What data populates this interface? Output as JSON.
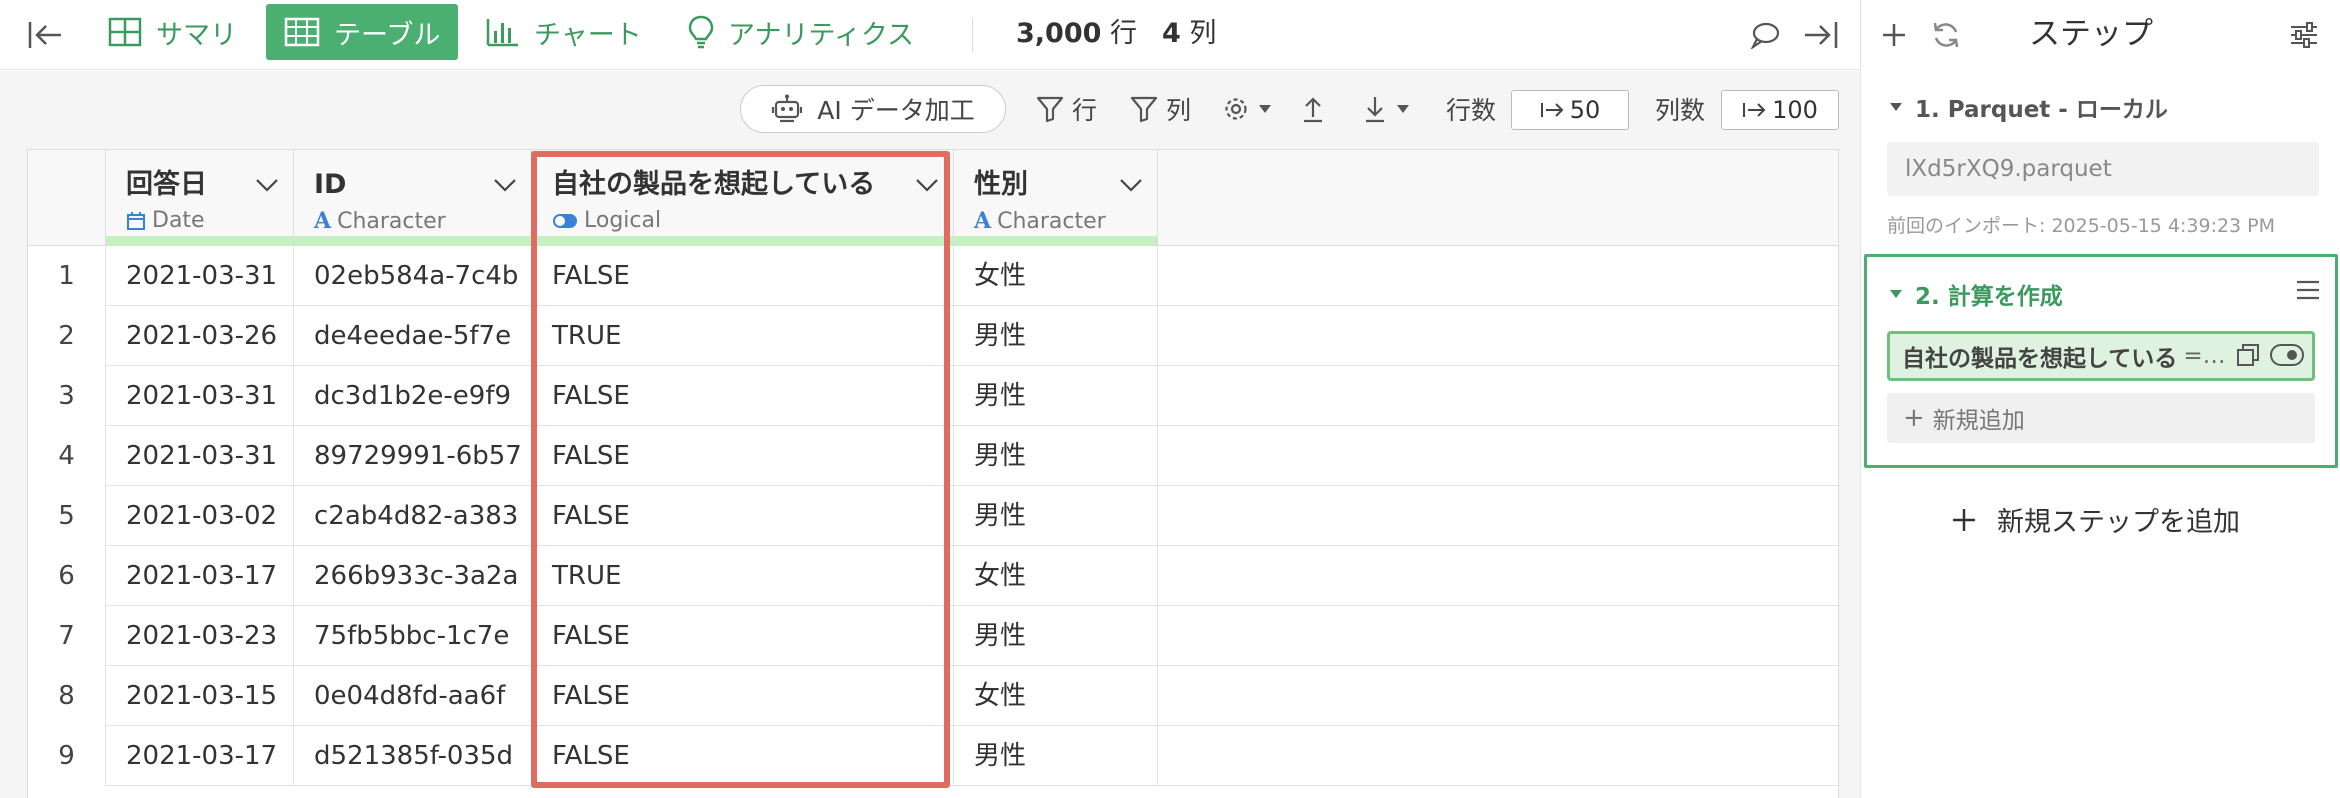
{
  "topbar": {
    "tabs": [
      {
        "label": "サマリ",
        "icon": "summary-grid-icon"
      },
      {
        "label": "テーブル",
        "icon": "table-icon",
        "active": true
      },
      {
        "label": "チャート",
        "icon": "bar-chart-icon"
      },
      {
        "label": "アナリティクス",
        "icon": "lightbulb-icon"
      }
    ],
    "rows_count": "3,000",
    "rows_unit": "行",
    "cols_count": "4",
    "cols_unit": "列"
  },
  "toolbar": {
    "ai_label": "AI データ加工",
    "row_filter": "行",
    "col_filter": "列",
    "rows_label": "行数",
    "rows_value": "50",
    "cols_label": "列数",
    "cols_value": "100"
  },
  "table": {
    "columns": [
      {
        "name": "回答日",
        "type": "Date"
      },
      {
        "name": "ID",
        "type": "Character"
      },
      {
        "name": "自社の製品を想起している",
        "type": "Logical"
      },
      {
        "name": "性別",
        "type": "Character"
      }
    ],
    "rows": [
      [
        "1",
        "2021-03-31",
        "02eb584a-7c4b",
        "FALSE",
        "女性"
      ],
      [
        "2",
        "2021-03-26",
        "de4eedae-5f7e",
        "TRUE",
        "男性"
      ],
      [
        "3",
        "2021-03-31",
        "dc3d1b2e-e9f9",
        "FALSE",
        "男性"
      ],
      [
        "4",
        "2021-03-31",
        "89729991-6b57",
        "FALSE",
        "男性"
      ],
      [
        "5",
        "2021-03-02",
        "c2ab4d82-a383",
        "FALSE",
        "男性"
      ],
      [
        "6",
        "2021-03-17",
        "266b933c-3a2a",
        "TRUE",
        "女性"
      ],
      [
        "7",
        "2021-03-23",
        "75fb5bbc-1c7e",
        "FALSE",
        "男性"
      ],
      [
        "8",
        "2021-03-15",
        "0e04d8fd-aa6f",
        "FALSE",
        "女性"
      ],
      [
        "9",
        "2021-03-17",
        "d521385f-035d",
        "FALSE",
        "男性"
      ]
    ]
  },
  "panel": {
    "title": "ステップ",
    "step1": {
      "title": "1. Parquet - ローカル",
      "file": "lXd5rXQ9.parquet",
      "meta": "前回のインポート: 2025-05-15 4:39:23 PM"
    },
    "step2": {
      "title": "2. 計算を作成",
      "item_name": "自社の製品を想起している",
      "item_eq": "=…",
      "add_label": "新規追加"
    },
    "add_step_label": "新規ステップを追加"
  },
  "colors": {
    "brand_green": "#4caf72",
    "highlight_red": "#e06b61",
    "type_bar_green": "#c6f0c2"
  }
}
